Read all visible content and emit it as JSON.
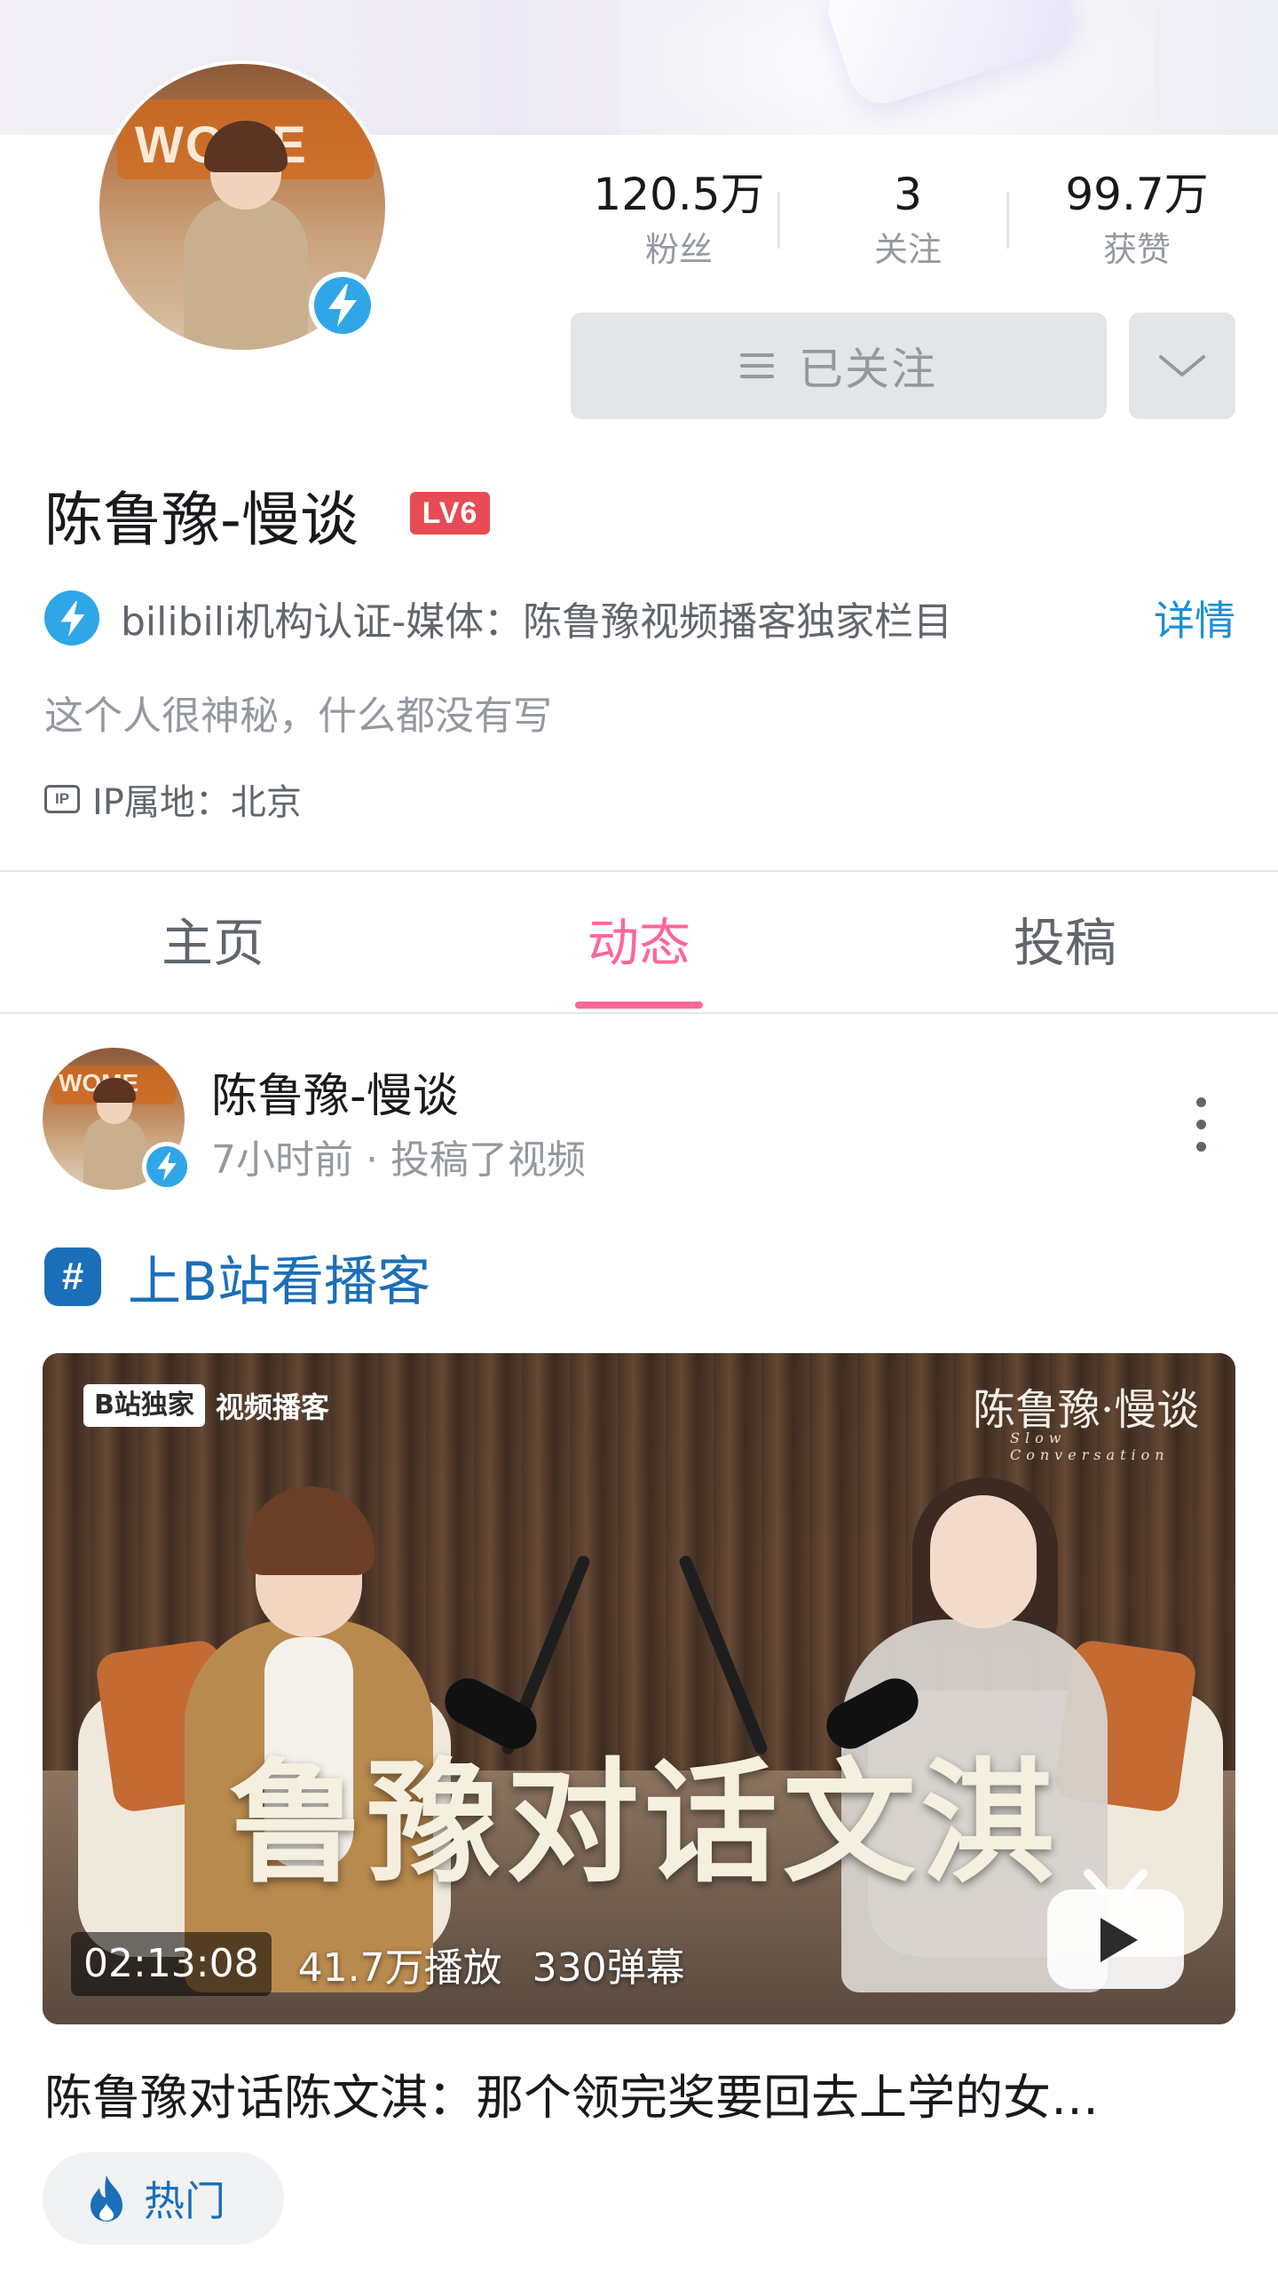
{
  "profile": {
    "name": "陈鲁豫-慢谈",
    "level": "LV6",
    "avatar_sign_text": "WOME",
    "stats": [
      {
        "value": "120.5万",
        "label": "粉丝"
      },
      {
        "value": "3",
        "label": "关注"
      },
      {
        "value": "99.7万",
        "label": "获赞"
      }
    ],
    "follow_label": "已关注",
    "certification": "bilibili机构认证-媒体：陈鲁豫视频播客独家栏目",
    "detail_label": "详情",
    "signature": "这个人很神秘，什么都没有写",
    "ip_badge": "IP",
    "ip_location": "IP属地：北京"
  },
  "tabs": [
    {
      "label": "主页",
      "active": false
    },
    {
      "label": "动态",
      "active": true
    },
    {
      "label": "投稿",
      "active": false
    }
  ],
  "post": {
    "author": "陈鲁豫-慢谈",
    "meta": "7小时前 · 投稿了视频",
    "topic": "上B站看播客",
    "video": {
      "exclusive_tag": "B站独家",
      "exclusive_sub": "视频播客",
      "series_logo": "陈鲁豫·慢谈",
      "series_logo_sub": "Slow Conversation",
      "cover_title": "鲁豫对话文淇",
      "duration": "02:13:08",
      "plays": "41.7万播放",
      "danmaku": "330弹幕"
    },
    "title": "陈鲁豫对话陈文淇：那个领完奖要回去上学的女…",
    "hot_tag": "热门"
  },
  "colors": {
    "accent_pink": "#ff6699",
    "link_blue": "#1b8fd6",
    "topic_blue": "#1b6fb8",
    "verify_blue": "#2fa6e8",
    "level_red": "#e84b55"
  },
  "icons": [
    "bolt-verified-icon",
    "menu-lines-icon",
    "chevron-down-icon",
    "ip-icon",
    "kebab-icon",
    "hashtag-icon",
    "bilibili-tv-icon",
    "flame-icon"
  ]
}
